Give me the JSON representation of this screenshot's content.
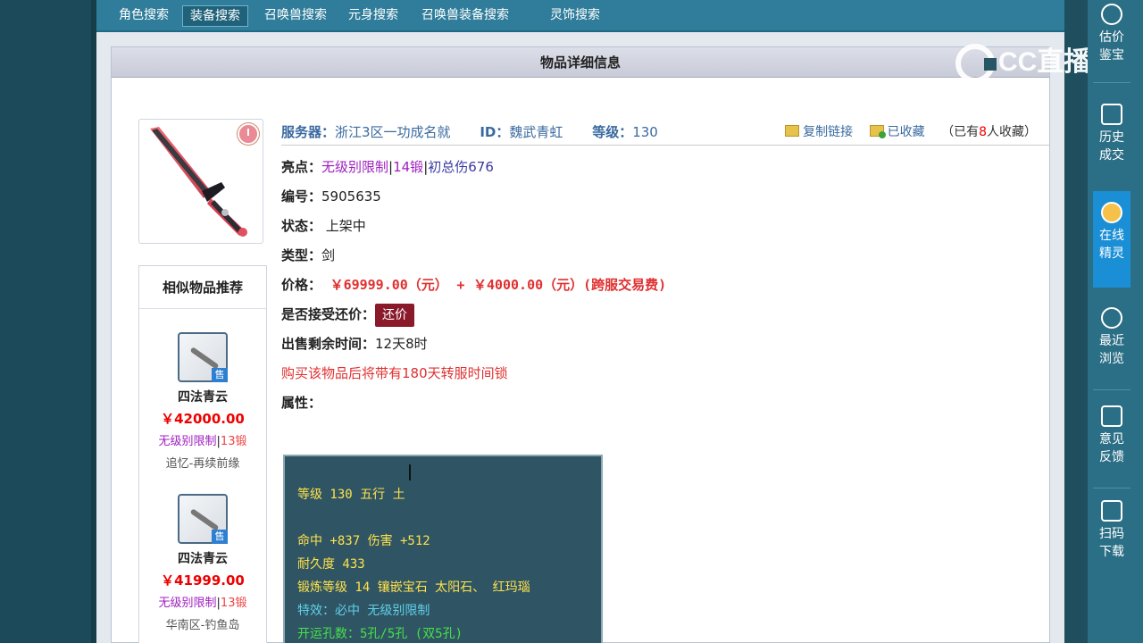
{
  "nav": {
    "tabs": [
      "角色搜索",
      "装备搜索",
      "召唤兽搜索",
      "元身搜索",
      "召唤兽装备搜索",
      "灵饰搜索"
    ],
    "active_tab": "装备搜索"
  },
  "panel": {
    "title": "物品详细信息"
  },
  "item": {
    "server_label": "服务器：",
    "server": "浙江3区一功成名就",
    "id_label": "ID：",
    "id": "魏武青虹",
    "level_label": "等级：",
    "level": "130",
    "copy_link": "复制链接",
    "favorited": "已收藏",
    "fav_prefix": "（已有",
    "fav_count": "8",
    "fav_suffix": "人收藏）",
    "highlight_label": "亮点：",
    "highlight_1": "无级别限制",
    "highlight_2": "14锻",
    "highlight_3": "初总伤676",
    "number_label": "编号：",
    "number": "5905635",
    "status_label": "状态：",
    "status": "上架中",
    "type_label": "类型：",
    "type": "剑",
    "price_label": "价格：",
    "price": "￥69999.00（元）",
    "price_plus": "+",
    "fee": "￥4000.00（元）(跨服交易费)",
    "haggle_label": "是否接受还价：",
    "haggle_button": "还价",
    "remaining_label": "出售剩余时间：",
    "remaining": "12天8时",
    "warning": "购买该物品后将带有180天转服时间锁",
    "attr_label": "属性："
  },
  "attributes": {
    "line1": "等级 130 五行 土",
    "line2": "命中 +837 伤害 +512",
    "line3": "耐久度 433",
    "line4": "锻炼等级 14 镶嵌宝石 太阳石、 红玛瑙",
    "line5": "特效：必中 无级别限制",
    "line6": "开运孔数：5孔/5孔 (双5孔)"
  },
  "similar": {
    "title": "相似物品推荐",
    "items": [
      {
        "name": "四法青云",
        "price": "￥42000.00",
        "tag1": "无级别限制",
        "tag2": "13锻",
        "server": "追忆-再续前缘",
        "sell": "售"
      },
      {
        "name": "四法青云",
        "price": "￥41999.00",
        "tag1": "无级别限制",
        "tag2": "13锻",
        "server": "华南区-钓鱼岛",
        "sell": "售"
      }
    ]
  },
  "rightbar": {
    "items": [
      "估价鉴宝",
      "历史成交",
      "在线精灵",
      "最近浏览",
      "意见反馈",
      "扫码下载"
    ]
  },
  "watermark": {
    "text": "CC直播"
  },
  "colors": {
    "accent": "#2f7d9a",
    "price": "#e03030",
    "tag": "#a020c0",
    "attr_bg": "#2f5564",
    "attr_text": "#ffe14a"
  }
}
